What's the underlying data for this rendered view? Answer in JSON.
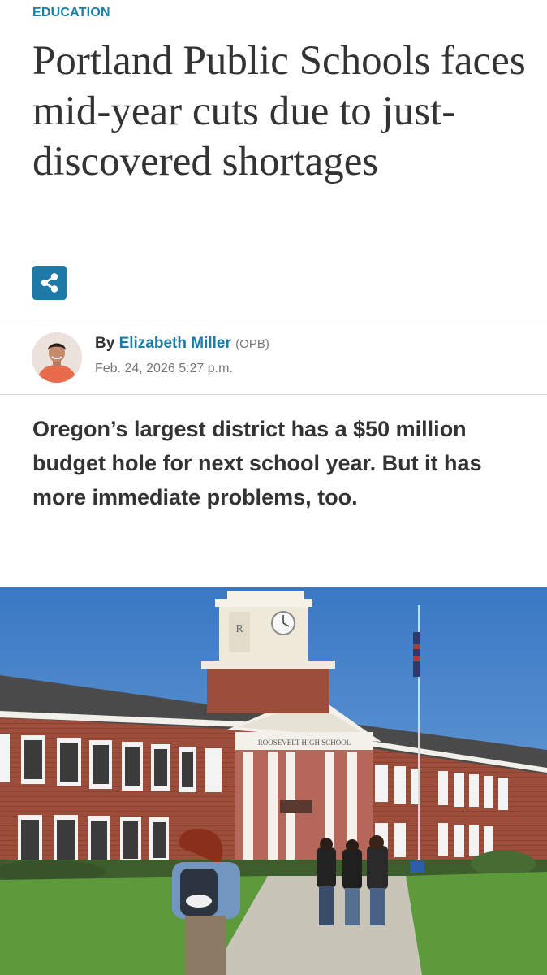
{
  "category": "EDUCATION",
  "headline": "Portland Public Schools faces mid-year cuts due to just-discovered shortages",
  "share_icon": "share-icon",
  "byline": {
    "by_prefix": "By",
    "author": "Elizabeth Miller",
    "org": "(OPB)",
    "date": "Feb. 24, 2026 5:27 p.m."
  },
  "dek": "Oregon’s largest district has a $50 million budget hole for next school year. But it has more immediate problems, too.",
  "photo": {
    "sign_text": "ROOSEVELT HIGH SCHOOL",
    "tower_letter": "R"
  },
  "colors": {
    "accent": "#1a7ea8",
    "text": "#333333",
    "muted": "#777777"
  }
}
